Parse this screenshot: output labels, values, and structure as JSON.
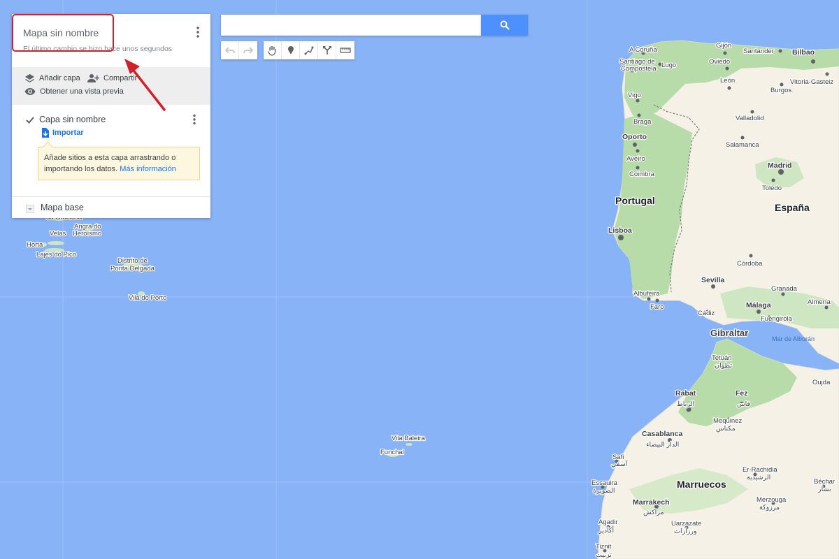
{
  "panel": {
    "title": "Mapa sin nombre",
    "subtitle": "El último cambio se hizo hace unos segundos",
    "actions": {
      "add_layer": "Añadir capa",
      "share": "Compartir",
      "preview": "Obtener una vista previa"
    },
    "layer": {
      "name": "Capa sin nombre",
      "checked": true,
      "import_label": "Importar",
      "tip_text": "Añade sitios a esta capa arrastrando o importando los datos.",
      "tip_link": "Más información"
    },
    "base_map": "Mapa base"
  },
  "search": {
    "value": "",
    "placeholder": ""
  },
  "toolbar": {
    "buttons": [
      "undo-icon",
      "redo-icon",
      "hand-icon",
      "marker-icon",
      "draw-line-icon",
      "directions-icon",
      "ruler-icon"
    ]
  },
  "map_labels": {
    "la_coruna": "A Coruña",
    "gijon": "Gijón",
    "santander": "Santander",
    "bilbao": "Bilbao",
    "santiago1": "Santiago de",
    "santiago2": "Compostela",
    "lugo": "Lugo",
    "oviedo": "Oviedo",
    "vitoria": "Vitoria-Gasteiz",
    "leon": "León",
    "burgos": "Burgos",
    "vigo": "Vigo",
    "braga": "Braga",
    "valladolid": "Valladolid",
    "oporto": "Oporto",
    "aveiro": "Aveiro",
    "salamanca": "Salamanca",
    "madrid": "Madrid",
    "coimbra": "Coimbra",
    "toledo": "Toledo",
    "portugal": "Portugal",
    "espana": "España",
    "lisboa": "Lisboa",
    "cordoba": "Córdoba",
    "sevilla": "Sevilla",
    "albufeira": "Albufeira",
    "faro": "Faro",
    "granada": "Granada",
    "almeria": "Almería",
    "cadiz": "Cádiz",
    "malaga": "Málaga",
    "fuengirola": "Fuengirola",
    "gibraltar": "Gibraltar",
    "alboran": "Mar de Alborán",
    "tetuan": "Tetuán",
    "tetuan_ar": "تطوان",
    "rabat": "Rabat",
    "rabat_ar": "الرباط",
    "fez": "Fez",
    "fez_ar": "فاس",
    "oujda": "Oujda",
    "mequinez": "Mequinez",
    "mequinez_ar": "مكناس",
    "casablanca": "Casablanca",
    "casablanca_ar": "الدار البيضاء",
    "safi": "Safi",
    "safi_ar": "آسفي",
    "er_rachidia": "Er-Rachidia",
    "er_rachidia_ar": "الرشيدية",
    "essaouira": "Essauira",
    "essaouira_ar": "الصويرة",
    "marruecos": "Marruecos",
    "bechar": "Béchar",
    "bechar_ar": "بشار",
    "marrakech": "Marrakech",
    "marrakech_ar": "مراكش",
    "merzouga": "Merzouga",
    "merzouga_ar": "مرزوكة",
    "agadir": "Agadir",
    "agadir_ar": "أكادير",
    "ouarzazate": "Uarzazate",
    "ouarzazate_ar": "ورزازات",
    "tiznit": "Tiznit",
    "tiznit_ar": "تزنيت",
    "graciosa": "da Graciosa",
    "angra1": "Angra do",
    "angra2": "Heroísmo",
    "velas": "Velas",
    "horta": "Horta",
    "lajes": "Lajes do Pico",
    "distrito1": "Distrito de",
    "distrito2": "Ponta Delgada",
    "vila_porto": "Vila do Porto",
    "vila_baleira": "Vila Baleira",
    "funchal": "Funchal"
  },
  "colors": {
    "sea": "#89b3f7",
    "land": "#f5f1e6",
    "green": "#b7dcaa",
    "highlight": "#d0202a",
    "accent": "#4d90fe"
  }
}
